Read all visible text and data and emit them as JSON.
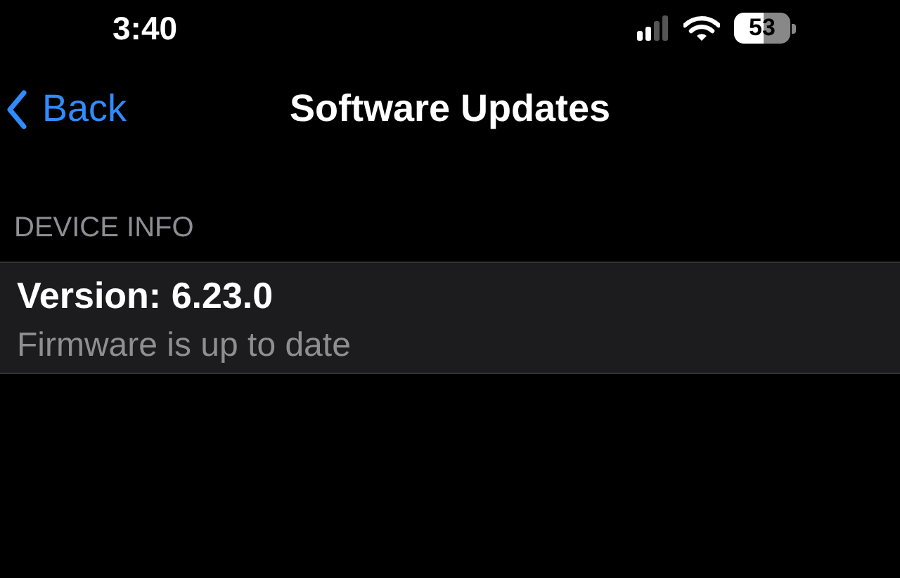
{
  "status_bar": {
    "time": "3:40",
    "battery": "53"
  },
  "nav": {
    "back": "Back",
    "title": "Software Updates"
  },
  "section": {
    "header": "DEVICE INFO",
    "rows": [
      {
        "title": "Version: 6.23.0",
        "subtitle": "Firmware is up to date"
      }
    ]
  }
}
